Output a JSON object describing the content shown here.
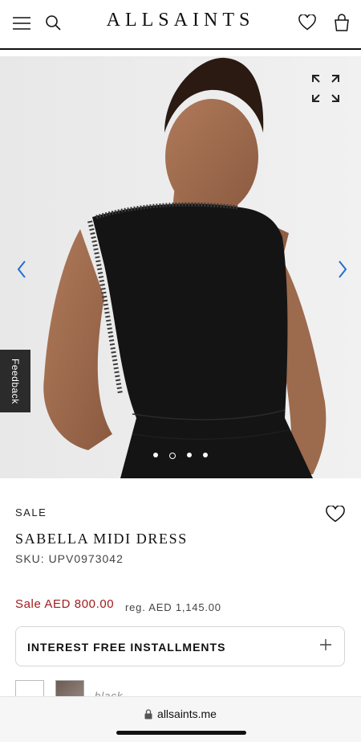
{
  "header": {
    "logo": "ALLSAINTS",
    "menu_icon": "hamburger-menu-icon",
    "search_icon": "search-icon",
    "wishlist_icon": "heart-icon",
    "bag_icon": "shopping-bag-icon"
  },
  "hero": {
    "image": "model wearing black sleeveless dress",
    "expand_icon": "expand-icon",
    "prev_icon": "chevron-left-icon",
    "next_icon": "chevron-right-icon",
    "slide_count": 4,
    "active_slide": 2
  },
  "feedback_tab": {
    "label": "Feedback"
  },
  "product": {
    "sale_tag": "SALE",
    "name": "SABELLA MIDI DRESS",
    "sku": "SKU: UPV0973042",
    "sale_price": "Sale AED 800.00",
    "regular_price": "reg. AED 1,145.00",
    "wishlist_icon": "heart-icon"
  },
  "installments": {
    "label": "INTEREST FREE INSTALLMENTS",
    "icon": "plus-icon"
  },
  "colors": {
    "selected_label": "black",
    "swatches": [
      "white",
      "black"
    ]
  },
  "browser": {
    "url": "allsaints.me",
    "lock_icon": "lock-icon"
  },
  "theme": {
    "accent_sale": "#a11b1b",
    "text": "#111111",
    "arrow": "#1f6fd1"
  }
}
